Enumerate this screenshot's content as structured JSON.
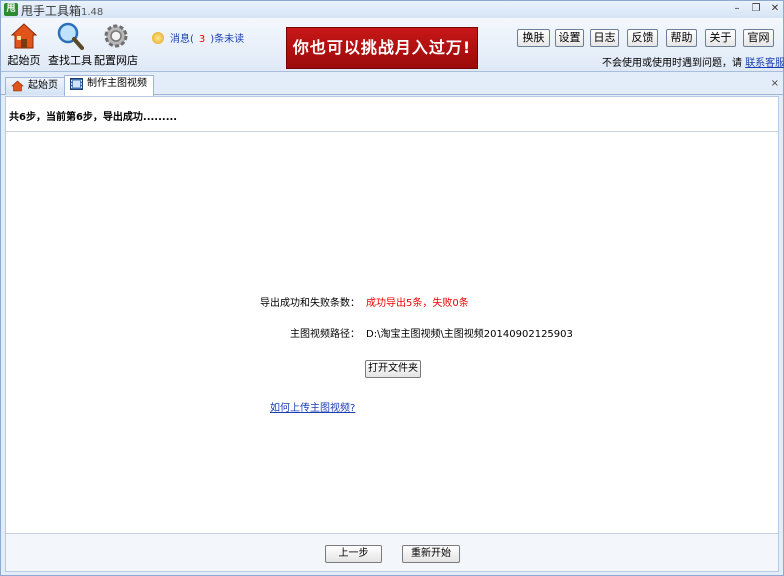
{
  "window": {
    "title": "甩手工具箱",
    "version": "1.48",
    "logo_text": "甩",
    "controls": {
      "minimize": "–",
      "restore": "❐",
      "close": "✕"
    }
  },
  "toolbar": {
    "items": [
      {
        "label": "起始页",
        "icon": "home-icon"
      },
      {
        "label": "查找工具",
        "icon": "search-icon"
      },
      {
        "label": "配置网店",
        "icon": "gear-icon"
      }
    ],
    "message": {
      "prefix": "消息(",
      "count": "3",
      "suffix": ")条未读"
    },
    "banner_text": "你也可以挑战月入过万!",
    "buttons": [
      "换肤",
      "设置",
      "日志",
      "反馈",
      "帮助",
      "关于",
      "官网"
    ],
    "help_text": "不会使用或使用时遇到问题，请",
    "help_link": "联系客服"
  },
  "tabs": [
    {
      "label": "起始页",
      "icon": "home-icon",
      "active": false
    },
    {
      "label": "制作主图视频",
      "icon": "film-icon",
      "active": true
    }
  ],
  "tab_close": "×",
  "main": {
    "step_text": "共6步，当前第6步，导出成功.........",
    "result_label": "导出成功和失败条数：",
    "result_value": "成功导出5条，失败0条",
    "path_label": "主图视频路径：",
    "path_value": "D:\\淘宝主图视频\\主图视频20140902125903",
    "open_folder": "打开文件夹",
    "upload_link": "如何上传主图视频?",
    "prev_button": "上一步",
    "restart_button": "重新开始"
  },
  "colors": {
    "accent_red": "#e00000",
    "link_blue": "#1a3fb0",
    "banner_red": "#c81717"
  }
}
